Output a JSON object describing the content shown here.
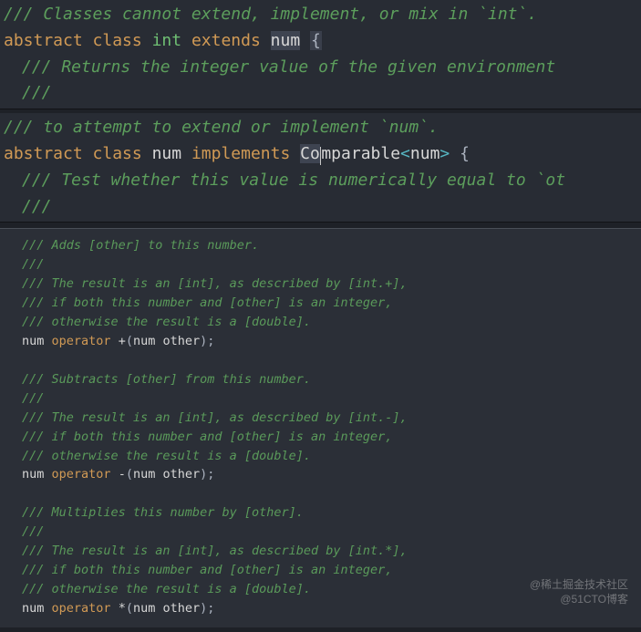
{
  "panel_top": {
    "l1": "/// Classes cannot extend, implement, or mix in `int`.",
    "l2": {
      "abstract": "abstract",
      "class_kw": "class",
      "type_int": "int",
      "extends": "extends",
      "type_num": "num",
      "lbrace": "{"
    },
    "l3": "/// Returns the integer value of the given environment",
    "l4": "///"
  },
  "panel_mid": {
    "l1": "/// to attempt to extend or implement `num`.",
    "l2": {
      "abstract": "abstract",
      "class_kw": "class",
      "type_num": "num",
      "implements": "implements",
      "comp_a": "Co",
      "comp_b": "mparable",
      "langle": "<",
      "gen": "num",
      "rangle": ">",
      "lbrace": "{"
    },
    "l3": "/// Test whether this value is numerically equal to `ot",
    "l4": "///"
  },
  "panel_bot": {
    "block1": {
      "c1": "/// Adds [other] to this number.",
      "c2": "///",
      "c3": "/// The result is an [int], as described by [int.+],",
      "c4": "/// if both this number and [other] is an integer,",
      "c5": "/// otherwise the result is a [double].",
      "sig_type": "num",
      "sig_op": "operator",
      "sig_sym": "+",
      "sig_p_open": "(",
      "sig_ptype": "num",
      "sig_pname": " other",
      "sig_p_close": ")",
      "sig_semi": ";"
    },
    "block2": {
      "c1": "/// Subtracts [other] from this number.",
      "c2": "///",
      "c3": "/// The result is an [int], as described by [int.-],",
      "c4": "/// if both this number and [other] is an integer,",
      "c5": "/// otherwise the result is a [double].",
      "sig_type": "num",
      "sig_op": "operator",
      "sig_sym": "-",
      "sig_p_open": "(",
      "sig_ptype": "num",
      "sig_pname": " other",
      "sig_p_close": ")",
      "sig_semi": ";"
    },
    "block3": {
      "c1": "/// Multiplies this number by [other].",
      "c2": "///",
      "c3": "/// The result is an [int], as described by [int.*],",
      "c4": "/// if both this number and [other] is an integer,",
      "c5": "/// otherwise the result is a [double].",
      "sig_type": "num",
      "sig_op": "operator",
      "sig_sym": "*",
      "sig_p_open": "(",
      "sig_ptype": "num",
      "sig_pname": " other",
      "sig_p_close": ")",
      "sig_semi": ";"
    }
  },
  "watermark1": "@稀土掘金技术社区",
  "watermark2": "@51CTO博客"
}
